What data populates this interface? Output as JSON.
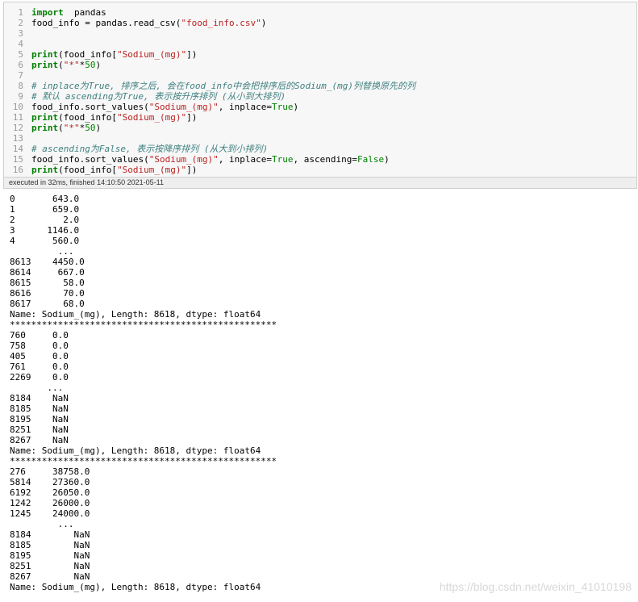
{
  "code_lines": [
    {
      "n": "1",
      "html_parts": [
        [
          "kw",
          "import"
        ],
        [
          "",
          "  pandas"
        ]
      ]
    },
    {
      "n": "2",
      "html_parts": [
        [
          "",
          "food_info = pandas.read_csv("
        ],
        [
          "str",
          "\"food_info.csv\""
        ],
        [
          "",
          ")"
        ]
      ]
    },
    {
      "n": "3",
      "html_parts": []
    },
    {
      "n": "4",
      "html_parts": []
    },
    {
      "n": "5",
      "html_parts": [
        [
          "kw",
          "print"
        ],
        [
          "",
          "(food_info["
        ],
        [
          "str",
          "\"Sodium_(mg)\""
        ],
        [
          "",
          "])"
        ]
      ]
    },
    {
      "n": "6",
      "html_parts": [
        [
          "kw",
          "print"
        ],
        [
          "",
          "("
        ],
        [
          "str",
          "\"*\""
        ],
        [
          "",
          "*"
        ],
        [
          "num",
          "50"
        ],
        [
          "",
          ")"
        ]
      ]
    },
    {
      "n": "7",
      "html_parts": []
    },
    {
      "n": "8",
      "html_parts": [
        [
          "cmt",
          "# inplace为True, 排序之后, 会在food_info中会把排序后的Sodium_(mg)列替换原先的列"
        ]
      ]
    },
    {
      "n": "9",
      "html_parts": [
        [
          "cmt",
          "# 默认 ascending为True, 表示按升序排列 (从小到大排列)"
        ]
      ]
    },
    {
      "n": "10",
      "html_parts": [
        [
          "",
          "food_info.sort_values("
        ],
        [
          "str",
          "\"Sodium_(mg)\""
        ],
        [
          "",
          ", inplace="
        ],
        [
          "bool",
          "True"
        ],
        [
          "",
          ")"
        ]
      ]
    },
    {
      "n": "11",
      "html_parts": [
        [
          "kw",
          "print"
        ],
        [
          "",
          "(food_info["
        ],
        [
          "str",
          "\"Sodium_(mg)\""
        ],
        [
          "",
          "])"
        ]
      ]
    },
    {
      "n": "12",
      "html_parts": [
        [
          "kw",
          "print"
        ],
        [
          "",
          "("
        ],
        [
          "str",
          "\"*\""
        ],
        [
          "",
          "*"
        ],
        [
          "num",
          "50"
        ],
        [
          "",
          ")"
        ]
      ]
    },
    {
      "n": "13",
      "html_parts": []
    },
    {
      "n": "14",
      "html_parts": [
        [
          "cmt",
          "# ascending为False, 表示按降序排列 (从大到小排列)"
        ]
      ]
    },
    {
      "n": "15",
      "html_parts": [
        [
          "",
          "food_info.sort_values("
        ],
        [
          "str",
          "\"Sodium_(mg)\""
        ],
        [
          "",
          ", inplace="
        ],
        [
          "bool",
          "True"
        ],
        [
          "",
          ", ascending="
        ],
        [
          "bool",
          "False"
        ],
        [
          "",
          ")"
        ]
      ]
    },
    {
      "n": "16",
      "html_parts": [
        [
          "kw",
          "print"
        ],
        [
          "",
          "(food_info["
        ],
        [
          "str",
          "\"Sodium_(mg)\""
        ],
        [
          "",
          "])"
        ]
      ]
    }
  ],
  "exec_status": "executed in 32ms, finished 14:10:50 2021-05-11",
  "output_text": "0       643.0\n1       659.0\n2         2.0\n3      1146.0\n4       560.0\n         ...\n8613    4450.0\n8614     667.0\n8615      58.0\n8616      70.0\n8617      68.0\nName: Sodium_(mg), Length: 8618, dtype: float64\n**************************************************\n760     0.0\n758     0.0\n405     0.0\n761     0.0\n2269    0.0\n       ...\n8184    NaN\n8185    NaN\n8195    NaN\n8251    NaN\n8267    NaN\nName: Sodium_(mg), Length: 8618, dtype: float64\n**************************************************\n276     38758.0\n5814    27360.0\n6192    26050.0\n1242    26000.0\n1245    24000.0\n         ...\n8184        NaN\n8185        NaN\n8195        NaN\n8251        NaN\n8267        NaN\nName: Sodium_(mg), Length: 8618, dtype: float64",
  "watermark": "https://blog.csdn.net/weixin_41010198"
}
